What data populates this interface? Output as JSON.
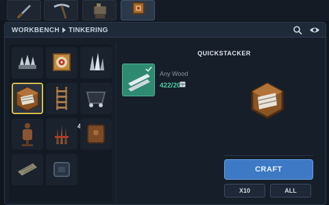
{
  "header": {
    "breadcrumb_root": "WORKBENCH",
    "breadcrumb_current": "TINKERING",
    "icons": [
      "search-icon",
      "eye-icon"
    ]
  },
  "tabs": [
    {
      "icon": "knife-tool-icon",
      "active": false
    },
    {
      "icon": "pickaxe-icon",
      "active": false
    },
    {
      "icon": "anvil-icon",
      "active": false
    },
    {
      "icon": "tinkering-crate-icon",
      "active": true
    }
  ],
  "recipes": {
    "items": [
      {
        "icon": "spike-trap-icon",
        "selected": false
      },
      {
        "icon": "target-block-icon",
        "selected": false
      },
      {
        "icon": "crystal-shards-icon",
        "selected": false
      },
      {
        "icon": "quickstacker-crate-icon",
        "selected": true
      },
      {
        "icon": "ladder-icon",
        "selected": false,
        "count": "4"
      },
      {
        "icon": "minecart-icon",
        "selected": false
      },
      {
        "icon": "mannequin-icon",
        "selected": false
      },
      {
        "icon": "stake-bundle-icon",
        "selected": false
      },
      {
        "icon": "wooden-sign-icon",
        "selected": false
      },
      {
        "icon": "blueprint-scroll-icon",
        "selected": false
      },
      {
        "icon": "machine-part-icon",
        "selected": false
      }
    ]
  },
  "detail": {
    "title": "QUICKSTACKER",
    "ingredient": {
      "name": "Any Wood",
      "quantity": "422/20",
      "icon": "wood-planks-icon",
      "storage_icon": "chest-icon",
      "available": true
    },
    "preview_icon": "quickstacker-crate-icon"
  },
  "actions": {
    "craft_label": "CRAFT",
    "x10_label": "X10",
    "all_label": "ALL"
  },
  "colors": {
    "accent": "#3d79c4",
    "selection": "#d8c24a",
    "ingredient_ok": "#4ec9a0"
  }
}
